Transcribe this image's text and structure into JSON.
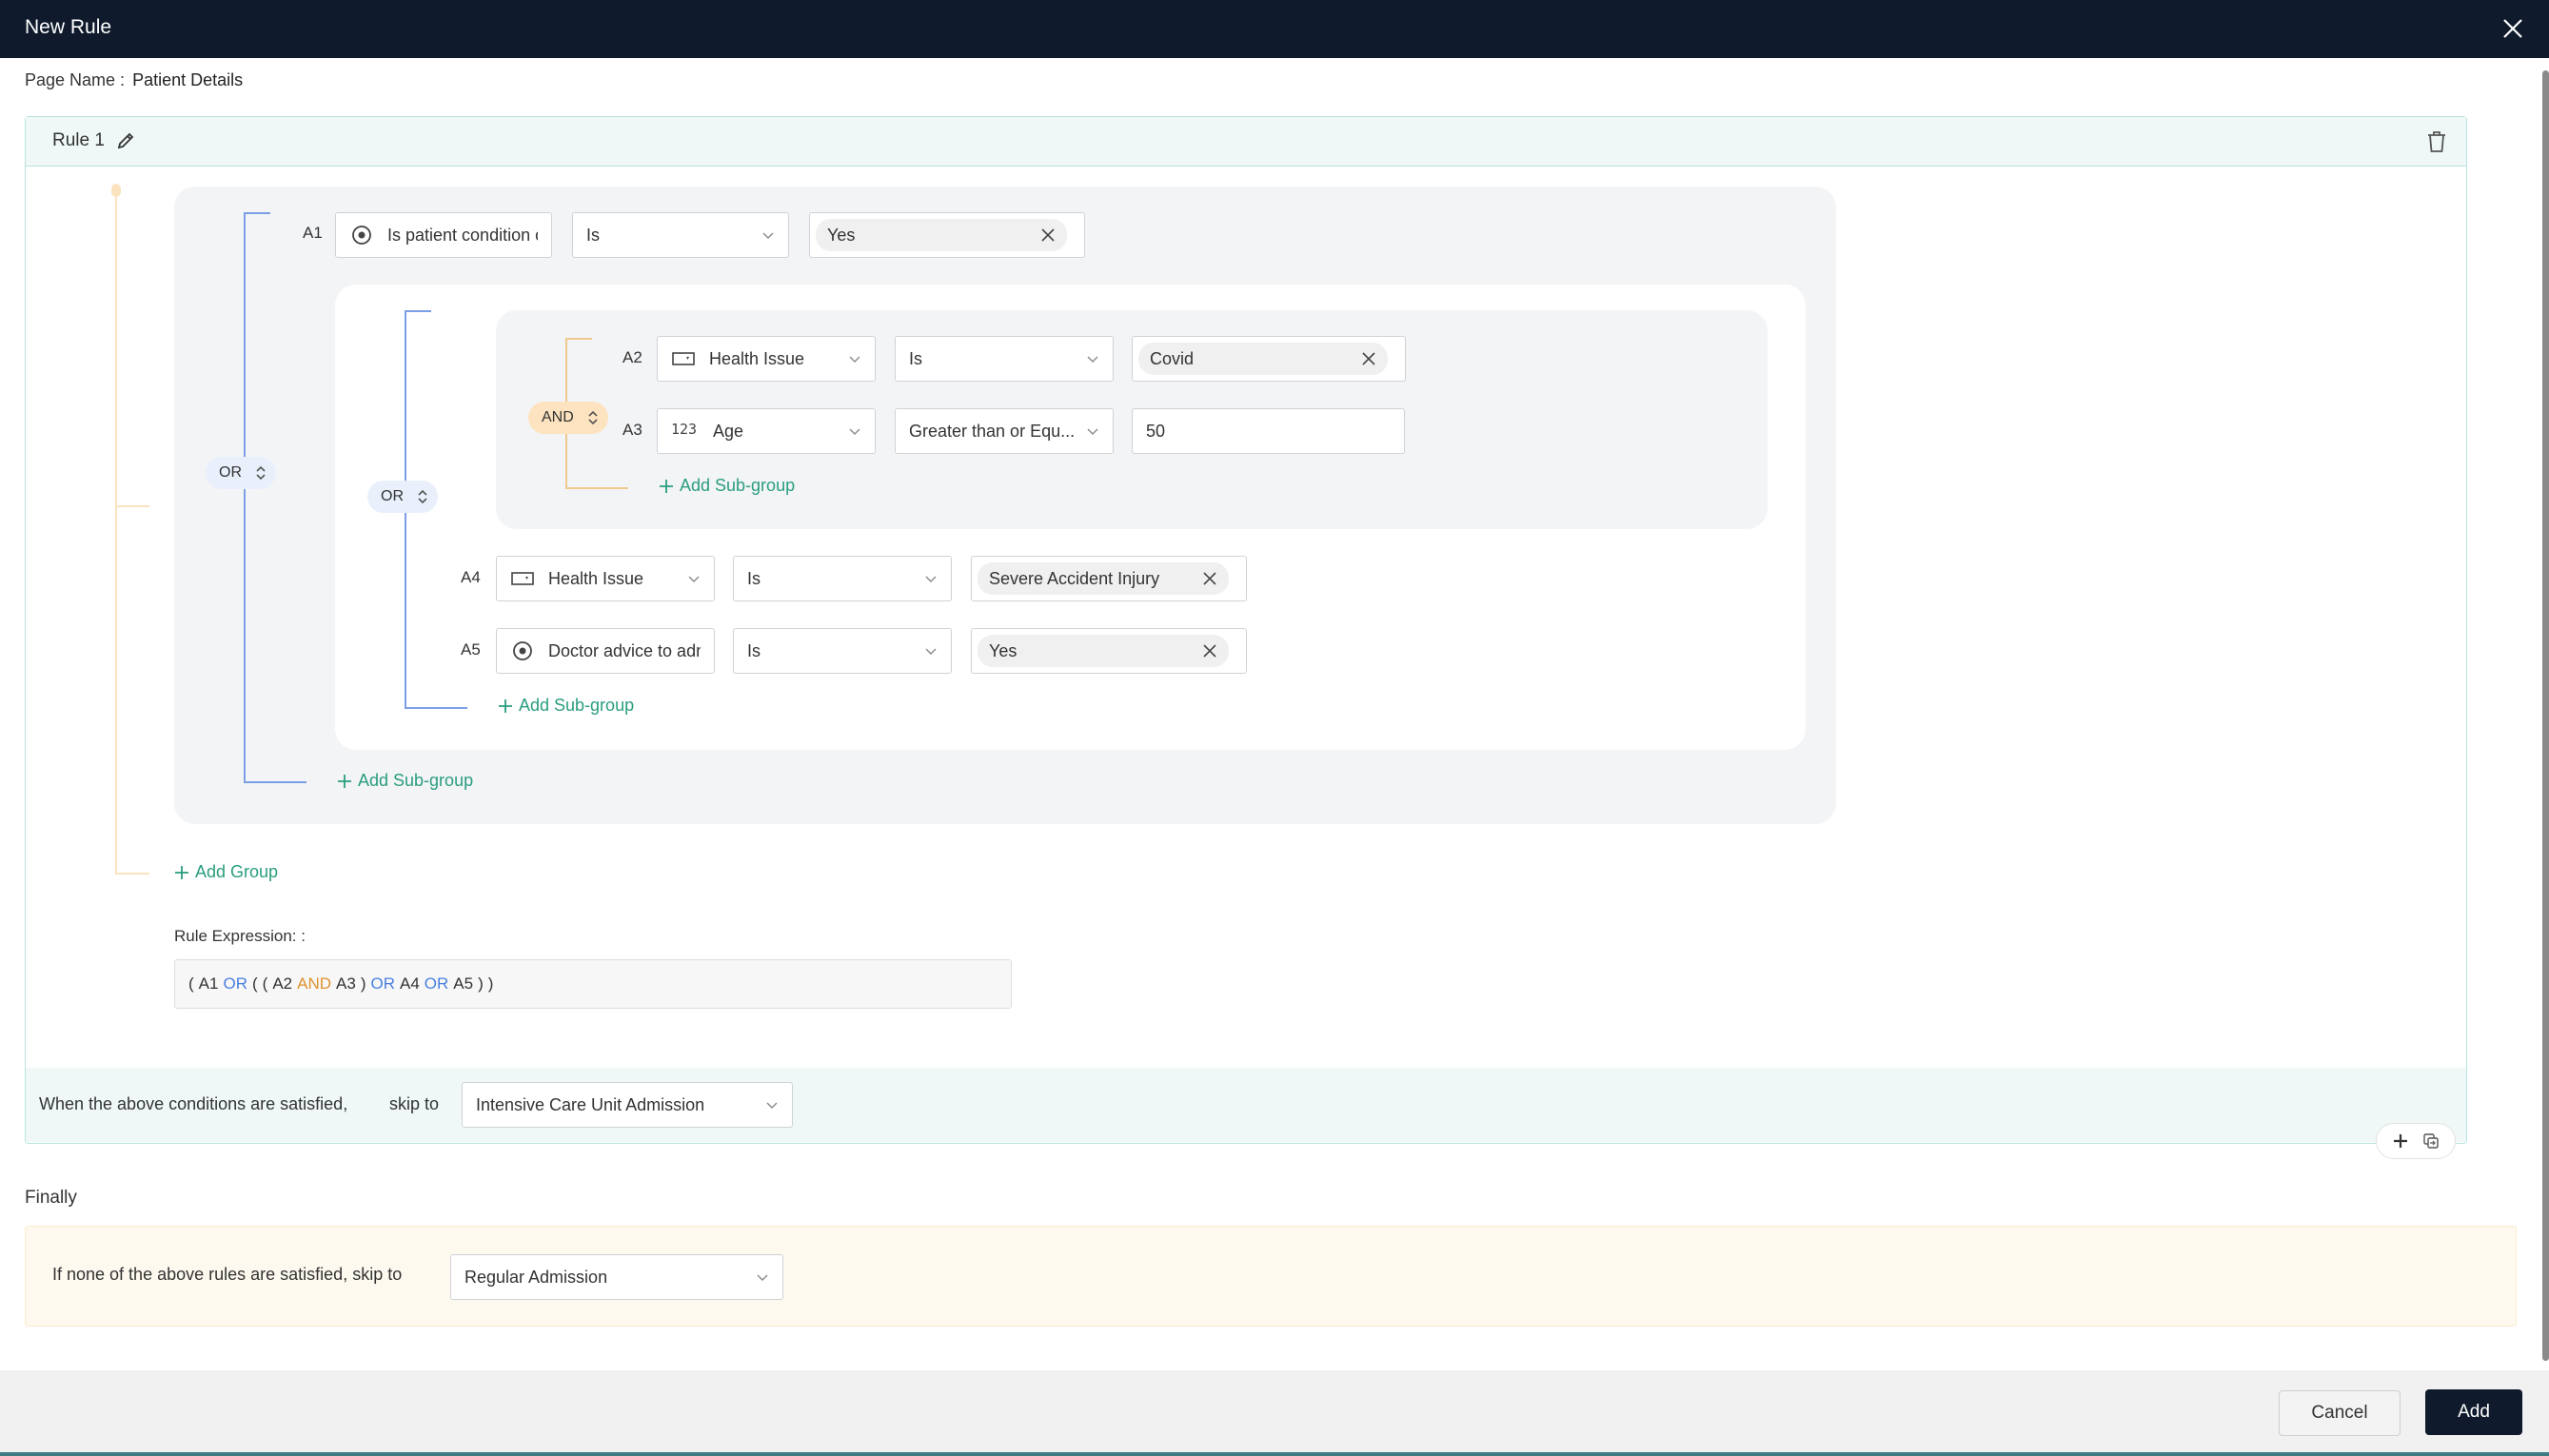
{
  "dialog": {
    "title": "New Rule",
    "close_icon": "close-icon"
  },
  "page": {
    "label": "Page Name :",
    "value": "Patient Details"
  },
  "rule": {
    "title": "Rule 1",
    "outer_group": {
      "operator": "OR",
      "conditions": {
        "a1": {
          "id": "A1",
          "field": "Is patient condition critical",
          "field_icon": "radio-icon",
          "operator": "Is",
          "value": "Yes"
        }
      },
      "sub_group": {
        "operator": "OR",
        "inner_group": {
          "operator": "AND",
          "conditions": {
            "a2": {
              "id": "A2",
              "field": "Health Issue",
              "field_icon": "dropdown-field-icon",
              "operator": "Is",
              "value": "Covid"
            },
            "a3": {
              "id": "A3",
              "field": "Age",
              "field_icon": "number-icon",
              "field_icon_text": "123",
              "operator": "Greater than or Equ...",
              "value": "50"
            }
          },
          "add_subgroup": "Add Sub-group"
        },
        "conditions": {
          "a4": {
            "id": "A4",
            "field": "Health Issue",
            "field_icon": "dropdown-field-icon",
            "operator": "Is",
            "value": "Severe Accident Injury"
          },
          "a5": {
            "id": "A5",
            "field": "Doctor advice to admit",
            "field_icon": "radio-icon",
            "operator": "Is",
            "value": "Yes"
          }
        },
        "add_subgroup": "Add Sub-group"
      },
      "add_subgroup": "Add Sub-group"
    },
    "add_group": "Add Group",
    "expression": {
      "label": "Rule Expression: :",
      "tokens": {
        "t0": "(",
        "t1": "A1",
        "t2": "OR",
        "t3": "(",
        "t4": "(",
        "t5": "A2",
        "t6": "AND",
        "t7": "A3",
        "t8": ")",
        "t9": "OR",
        "t10": "A4",
        "t11": "OR",
        "t12": "A5",
        "t13": ")",
        "t14": ")"
      }
    },
    "skip": {
      "label": "When the above conditions are satisfied,",
      "label2": "skip to",
      "value": "Intensive Care Unit Admission"
    }
  },
  "finally": {
    "heading": "Finally",
    "label": "If none of the above rules are satisfied, skip to",
    "value": "Regular Admission"
  },
  "footer": {
    "cancel": "Cancel",
    "add": "Add"
  },
  "colors": {
    "header_bg": "#0f1b2d",
    "or_line": "#7b9fe6",
    "and_line": "#f0c98e",
    "link": "#2a9d7f",
    "or_text": "#4a7fe0",
    "and_text": "#e0922d"
  }
}
